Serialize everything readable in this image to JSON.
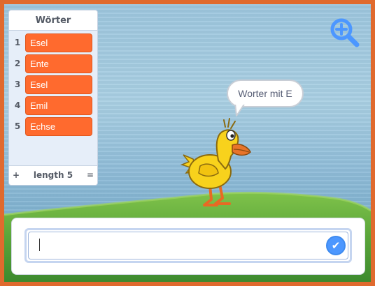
{
  "list_monitor": {
    "title": "Wörter",
    "items": [
      {
        "index": "1",
        "value": "Esel"
      },
      {
        "index": "2",
        "value": "Ente"
      },
      {
        "index": "3",
        "value": "Esel"
      },
      {
        "index": "4",
        "value": "Emil"
      },
      {
        "index": "5",
        "value": "Echse"
      }
    ],
    "add_label": "+",
    "length_label": "length 5",
    "resize_label": "="
  },
  "sprite": {
    "speech": "Worter mit E"
  },
  "ask": {
    "value": "",
    "submit_glyph": "✔"
  },
  "icons": {
    "zoom": "zoom-in-icon",
    "submit": "check-icon"
  },
  "colors": {
    "frame": "#E06A2E",
    "list_item": "#FF6A2E",
    "submit": "#4C97FF",
    "zoom": "#4C97FF"
  }
}
